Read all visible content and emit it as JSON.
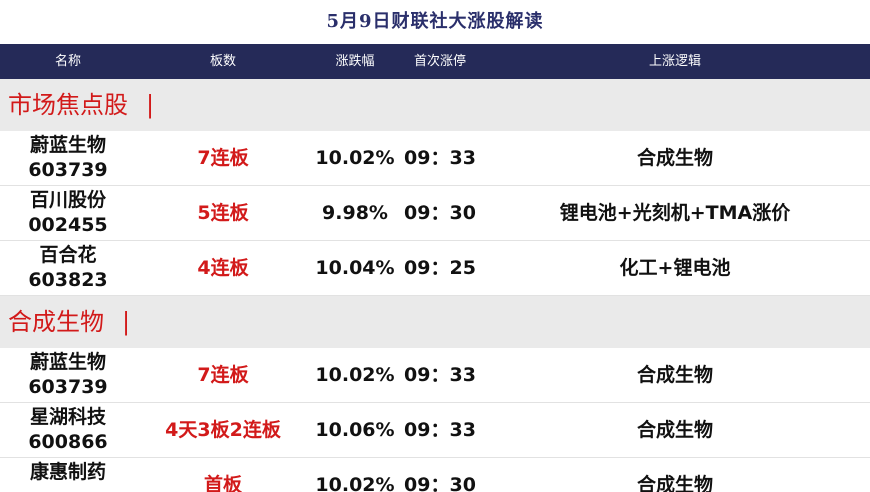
{
  "title": "5月9日财联社大涨股解读",
  "header": {
    "name": "名称",
    "boards": "板数",
    "change": "涨跌幅",
    "first_limit": "首次涨停",
    "logic": "上涨逻辑"
  },
  "sections": [
    {
      "title": "市场焦点股",
      "bar": "|",
      "rows": [
        {
          "name": "蔚蓝生物",
          "code": "603739",
          "boards": "7连板",
          "change": "10.02%",
          "time": "09：33",
          "logic": "合成生物"
        },
        {
          "name": "百川股份",
          "code": "002455",
          "boards": "5连板",
          "change": "9.98%",
          "time": "09：30",
          "logic": "锂电池+光刻机+TMA涨价"
        },
        {
          "name": "百合花",
          "code": "603823",
          "boards": "4连板",
          "change": "10.04%",
          "time": "09：25",
          "logic": "化工+锂电池"
        }
      ]
    },
    {
      "title": "合成生物",
      "bar": "|",
      "rows": [
        {
          "name": "蔚蓝生物",
          "code": "603739",
          "boards": "7连板",
          "change": "10.02%",
          "time": "09：33",
          "logic": "合成生物"
        },
        {
          "name": "星湖科技",
          "code": "600866",
          "boards": "4天3板2连板",
          "change": "10.06%",
          "time": "09：33",
          "logic": "合成生物"
        },
        {
          "name": "康惠制药",
          "code": "",
          "boards": "首板",
          "change": "10.02%",
          "time": "09：30",
          "logic": "合成生物"
        }
      ]
    }
  ]
}
